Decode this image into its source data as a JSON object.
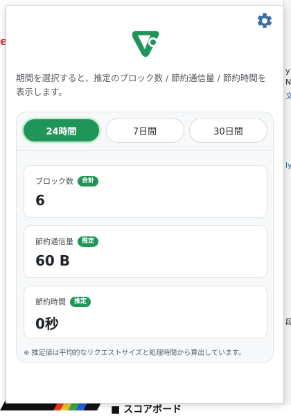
{
  "background": {
    "fragments": [
      {
        "text": "e"
      },
      {
        "text": "y"
      },
      {
        "text": "N"
      },
      {
        "text": "文"
      },
      {
        "text": "ly"
      },
      {
        "text": "段"
      },
      {
        "text": "■ スコアボード"
      }
    ]
  },
  "popup": {
    "gear_icon": "gear-icon",
    "logo_icon": "logo-icon",
    "description": "期間を選択すると、推定のブロック数 / 節約通信量 / 節約時間を表示します。",
    "tabs": [
      {
        "label": "24時間",
        "active": true
      },
      {
        "label": "7日間",
        "active": false
      },
      {
        "label": "30日間",
        "active": false
      }
    ],
    "cards": [
      {
        "label": "ブロック数",
        "badge": "合計",
        "value": "6"
      },
      {
        "label": "節約通信量",
        "badge": "推定",
        "value": "60 B"
      },
      {
        "label": "節約時間",
        "badge": "推定",
        "value": "0秒"
      }
    ],
    "note": "※ 推定値は平均的なリクエストサイズと処理時間から算出しています。"
  },
  "colors": {
    "accent": "#1f9657",
    "gear": "#3f6fa8"
  }
}
